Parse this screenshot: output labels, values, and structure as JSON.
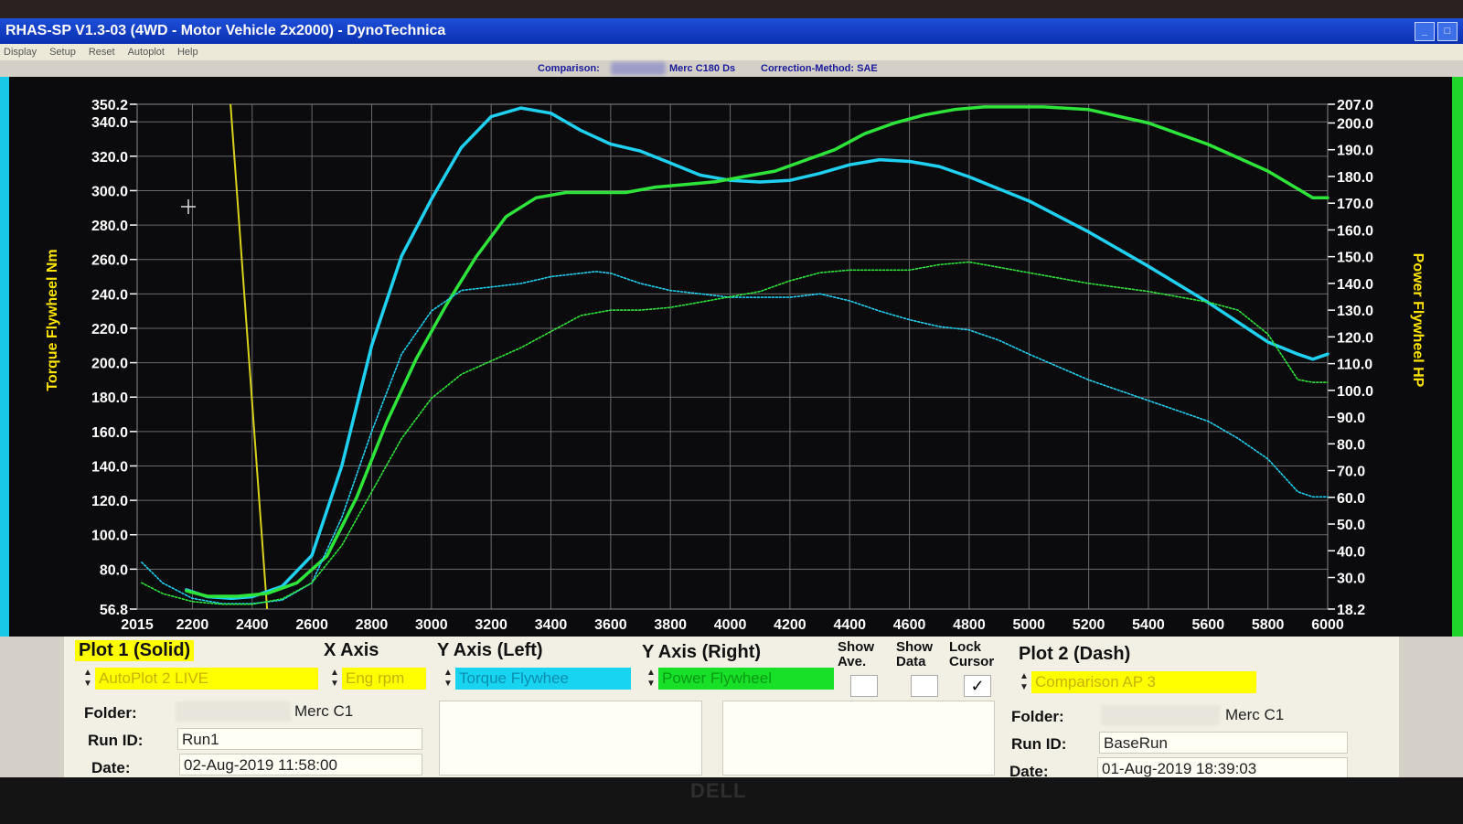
{
  "window": {
    "title": "RHAS-SP V1.3-03  (4WD - Motor Vehicle 2x2000) - DynoTechnica",
    "buttons": [
      "_",
      "□"
    ]
  },
  "menu": [
    "Display",
    "Setup",
    "Reset",
    "Autoplot",
    "Help"
  ],
  "infobar": {
    "comparison_label": "Comparison:",
    "vehicle": "Merc C180 Ds",
    "correction": "Correction-Method: SAE"
  },
  "colors": {
    "cyan": "#1fd0f0",
    "green": "#2ee43a",
    "yellow_line": "#d9d21c",
    "axis_label": "#ffe400",
    "grid": "#6a6a6a"
  },
  "chart_data": {
    "type": "line",
    "xlabel": "",
    "x_ticks": [
      2015,
      2200,
      2400,
      2600,
      2800,
      3000,
      3200,
      3400,
      3600,
      3800,
      4000,
      4200,
      4400,
      4600,
      4800,
      5000,
      5200,
      5400,
      5600,
      5800,
      6000
    ],
    "xlim": [
      2015,
      6000
    ],
    "y_left": {
      "label": "Torque Flywheel Nm",
      "lim": [
        56.8,
        350.2
      ],
      "ticks": [
        56.8,
        80.0,
        100.0,
        120.0,
        140.0,
        160.0,
        180.0,
        200.0,
        220.0,
        240.0,
        260.0,
        280.0,
        300.0,
        320.0,
        340.0,
        350.2
      ]
    },
    "y_right": {
      "label": "Power Flywheel HP",
      "lim": [
        18.2,
        207.0
      ],
      "ticks": [
        18.2,
        30.0,
        40.0,
        50.0,
        60.0,
        70.0,
        80.0,
        90.0,
        100.0,
        110.0,
        120.0,
        130.0,
        140.0,
        150.0,
        160.0,
        170.0,
        180.0,
        190.0,
        200.0,
        207.0
      ]
    },
    "grid": true,
    "vertical_marker_x": 2450,
    "series": [
      {
        "axis": "left",
        "color": "cyan",
        "style": "solid",
        "x": [
          2180,
          2250,
          2330,
          2400,
          2500,
          2600,
          2700,
          2800,
          2900,
          3000,
          3100,
          3200,
          3300,
          3400,
          3500,
          3600,
          3700,
          3800,
          3900,
          4000,
          4100,
          4200,
          4300,
          4400,
          4500,
          4600,
          4700,
          4800,
          4900,
          5000,
          5200,
          5400,
          5600,
          5800,
          5900,
          5950,
          6000
        ],
        "y": [
          68,
          64,
          63,
          64,
          70,
          88,
          140,
          210,
          262,
          295,
          325,
          343,
          348,
          345,
          335,
          327,
          323,
          316,
          309,
          306,
          305,
          306,
          310,
          315,
          318,
          317,
          314,
          308,
          301,
          294,
          276,
          256,
          235,
          212,
          205,
          202,
          205
        ]
      },
      {
        "axis": "right",
        "color": "green",
        "style": "solid",
        "x": [
          2180,
          2250,
          2350,
          2450,
          2550,
          2650,
          2750,
          2850,
          2950,
          3050,
          3150,
          3250,
          3350,
          3450,
          3550,
          3650,
          3750,
          3850,
          3950,
          4050,
          4150,
          4250,
          4350,
          4450,
          4550,
          4650,
          4750,
          4850,
          4950,
          5050,
          5200,
          5400,
          5600,
          5800,
          5950,
          6000
        ],
        "y": [
          25,
          23,
          23,
          24,
          28,
          38,
          60,
          88,
          112,
          132,
          150,
          165,
          172,
          174,
          174,
          174,
          176,
          177,
          178,
          180,
          182,
          186,
          190,
          196,
          200,
          203,
          205,
          206,
          206,
          206,
          205,
          200,
          192,
          182,
          172,
          172
        ]
      },
      {
        "axis": "left",
        "color": "cyan",
        "style": "dashed",
        "x": [
          2030,
          2100,
          2200,
          2300,
          2400,
          2500,
          2600,
          2700,
          2800,
          2900,
          3000,
          3100,
          3200,
          3300,
          3400,
          3500,
          3550,
          3600,
          3700,
          3800,
          3900,
          4000,
          4100,
          4200,
          4300,
          4400,
          4500,
          4600,
          4700,
          4800,
          4900,
          5000,
          5200,
          5400,
          5600,
          5700,
          5800,
          5900,
          5950,
          6000
        ],
        "y": [
          84,
          72,
          63,
          60,
          60,
          62,
          72,
          110,
          160,
          205,
          230,
          242,
          244,
          246,
          250,
          252,
          253,
          252,
          246,
          242,
          240,
          238,
          238,
          238,
          240,
          236,
          230,
          225,
          221,
          219,
          213,
          205,
          190,
          178,
          166,
          156,
          144,
          125,
          122,
          122
        ]
      },
      {
        "axis": "right",
        "color": "green",
        "style": "dashed",
        "x": [
          2030,
          2100,
          2200,
          2300,
          2400,
          2500,
          2600,
          2700,
          2800,
          2900,
          3000,
          3100,
          3200,
          3300,
          3400,
          3500,
          3600,
          3700,
          3800,
          3900,
          4000,
          4100,
          4200,
          4300,
          4400,
          4500,
          4600,
          4700,
          4800,
          4900,
          5000,
          5200,
          5400,
          5600,
          5700,
          5800,
          5900,
          5950,
          6000
        ],
        "y": [
          28,
          24,
          21,
          20,
          20,
          22,
          28,
          42,
          62,
          82,
          97,
          106,
          111,
          116,
          122,
          128,
          130,
          130,
          131,
          133,
          135,
          137,
          141,
          144,
          145,
          145,
          145,
          147,
          148,
          146,
          144,
          140,
          137,
          133,
          130,
          121,
          104,
          103,
          103
        ]
      }
    ]
  },
  "controls": {
    "plot1_header": "Plot 1 (Solid)",
    "x_axis_header": "X Axis",
    "y_left_header": "Y Axis (Left)",
    "y_right_header": "Y Axis (Right)",
    "show_ave_label": "Show Ave.",
    "show_data_label": "Show Data",
    "lock_cursor_label": "Lock Cursor",
    "plot2_header": "Plot 2 (Dash)",
    "plot1_source": "AutoPlot 2 LIVE",
    "x_axis_value": "Eng rpm",
    "y_left_value": "Torque Flywhee",
    "y_right_value": "Power Flywheel",
    "plot2_source": "Comparison AP 3",
    "lock_cursor_check": "✓",
    "plot1": {
      "folder_label": "Folder:",
      "folder_value": "Merc C1",
      "runid_label": "Run ID:",
      "runid_value": "Run1",
      "date_label": "Date:",
      "date_value": "02-Aug-2019  11:58:00"
    },
    "plot2": {
      "folder_label": "Folder:",
      "folder_value": "Merc C1",
      "runid_label": "Run ID:",
      "runid_value": "BaseRun",
      "date_label": "Date:",
      "date_value": "01-Aug-2019  18:39:03"
    }
  },
  "bezel": {
    "brand": "DELL"
  }
}
